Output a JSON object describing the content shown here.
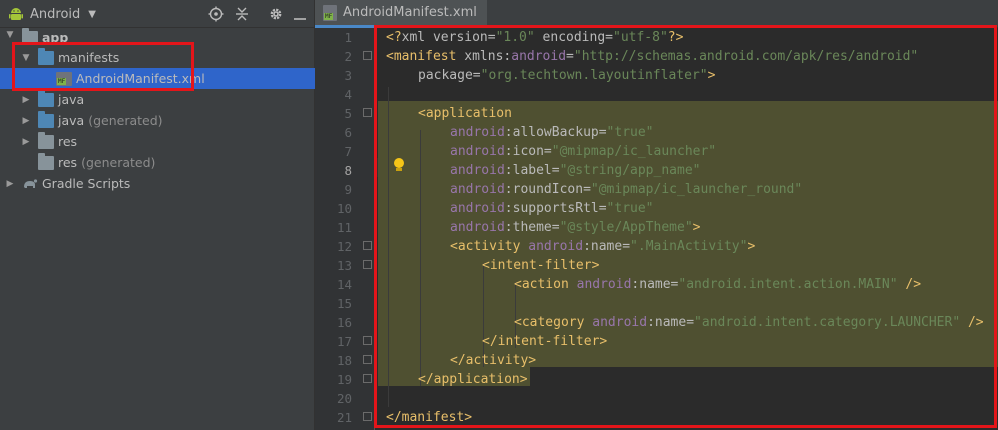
{
  "project": {
    "view_label": "Android",
    "tree": [
      {
        "label": "app",
        "suffix": ""
      },
      {
        "label": "manifests",
        "suffix": ""
      },
      {
        "label": "AndroidManifest.xml",
        "suffix": ""
      },
      {
        "label": "java",
        "suffix": ""
      },
      {
        "label": "java",
        "suffix": "(generated)"
      },
      {
        "label": "res",
        "suffix": ""
      },
      {
        "label": "res",
        "suffix": "(generated)"
      },
      {
        "label": "Gradle Scripts",
        "suffix": ""
      }
    ]
  },
  "editor": {
    "tab_label": "AndroidManifest.xml",
    "current_line": 8,
    "line_numbers": [
      "1",
      "2",
      "3",
      "4",
      "5",
      "6",
      "7",
      "8",
      "9",
      "10",
      "11",
      "12",
      "13",
      "14",
      "15",
      "16",
      "17",
      "18",
      "19",
      "20",
      "21"
    ],
    "code": {
      "l1": {
        "a": "<?",
        "b": "xml version=",
        "c": "\"1.0\"",
        "d": " encoding=",
        "e": "\"utf-8\"",
        "f": "?>"
      },
      "l2": {
        "a": "<manifest ",
        "b": "xmlns:",
        "c": "android",
        "d": "=",
        "e": "\"http://schemas.android.com/apk/res/android\""
      },
      "l3": {
        "a": "package=",
        "b": "\"org.techtown.layoutinflater\"",
        "c": ">"
      },
      "l5": {
        "a": "<application"
      },
      "l6": {
        "ns": "android",
        "attr": ":allowBackup=",
        "val": "\"true\""
      },
      "l7": {
        "ns": "android",
        "attr": ":icon=",
        "val": "\"@mipmap/ic_launcher\""
      },
      "l8": {
        "ns": "android",
        "attr": ":label=",
        "val": "\"@string/app_name\""
      },
      "l9": {
        "ns": "android",
        "attr": ":roundIcon=",
        "val": "\"@mipmap/ic_launcher_round\""
      },
      "l10": {
        "ns": "android",
        "attr": ":supportsRtl=",
        "val": "\"true\""
      },
      "l11": {
        "ns": "android",
        "attr": ":theme=",
        "val": "\"@style/AppTheme\"",
        "end": ">"
      },
      "l12": {
        "tag": "<activity ",
        "ns": "android",
        "attr": ":name=",
        "val": "\".MainActivity\"",
        "end": ">"
      },
      "l13": {
        "tag": "<intent-filter>"
      },
      "l14": {
        "tag": "<action ",
        "ns": "android",
        "attr": ":name=",
        "val": "\"android.intent.action.MAIN\"",
        "end": " />"
      },
      "l16": {
        "tag": "<category ",
        "ns": "android",
        "attr": ":name=",
        "val": "\"android.intent.category.LAUNCHER\"",
        "end": " />"
      },
      "l17": {
        "tag": "</intent-filter>"
      },
      "l18": {
        "tag": "</activity>"
      },
      "l19": {
        "tag": "</application>"
      },
      "l21": {
        "tag": "</manifest>"
      }
    }
  },
  "icons": {
    "android": "android-icon",
    "target": "locate-icon",
    "collapse": "collapse-all-icon",
    "settings": "gear-icon",
    "hide": "hide-icon",
    "bulb": "lightbulb-icon"
  },
  "colors": {
    "highlight_box": "#e4151a",
    "selection": "#4f5031",
    "tag": "#e8bf6a",
    "attr_value": "#6a8759",
    "namespace": "#9876aa"
  }
}
